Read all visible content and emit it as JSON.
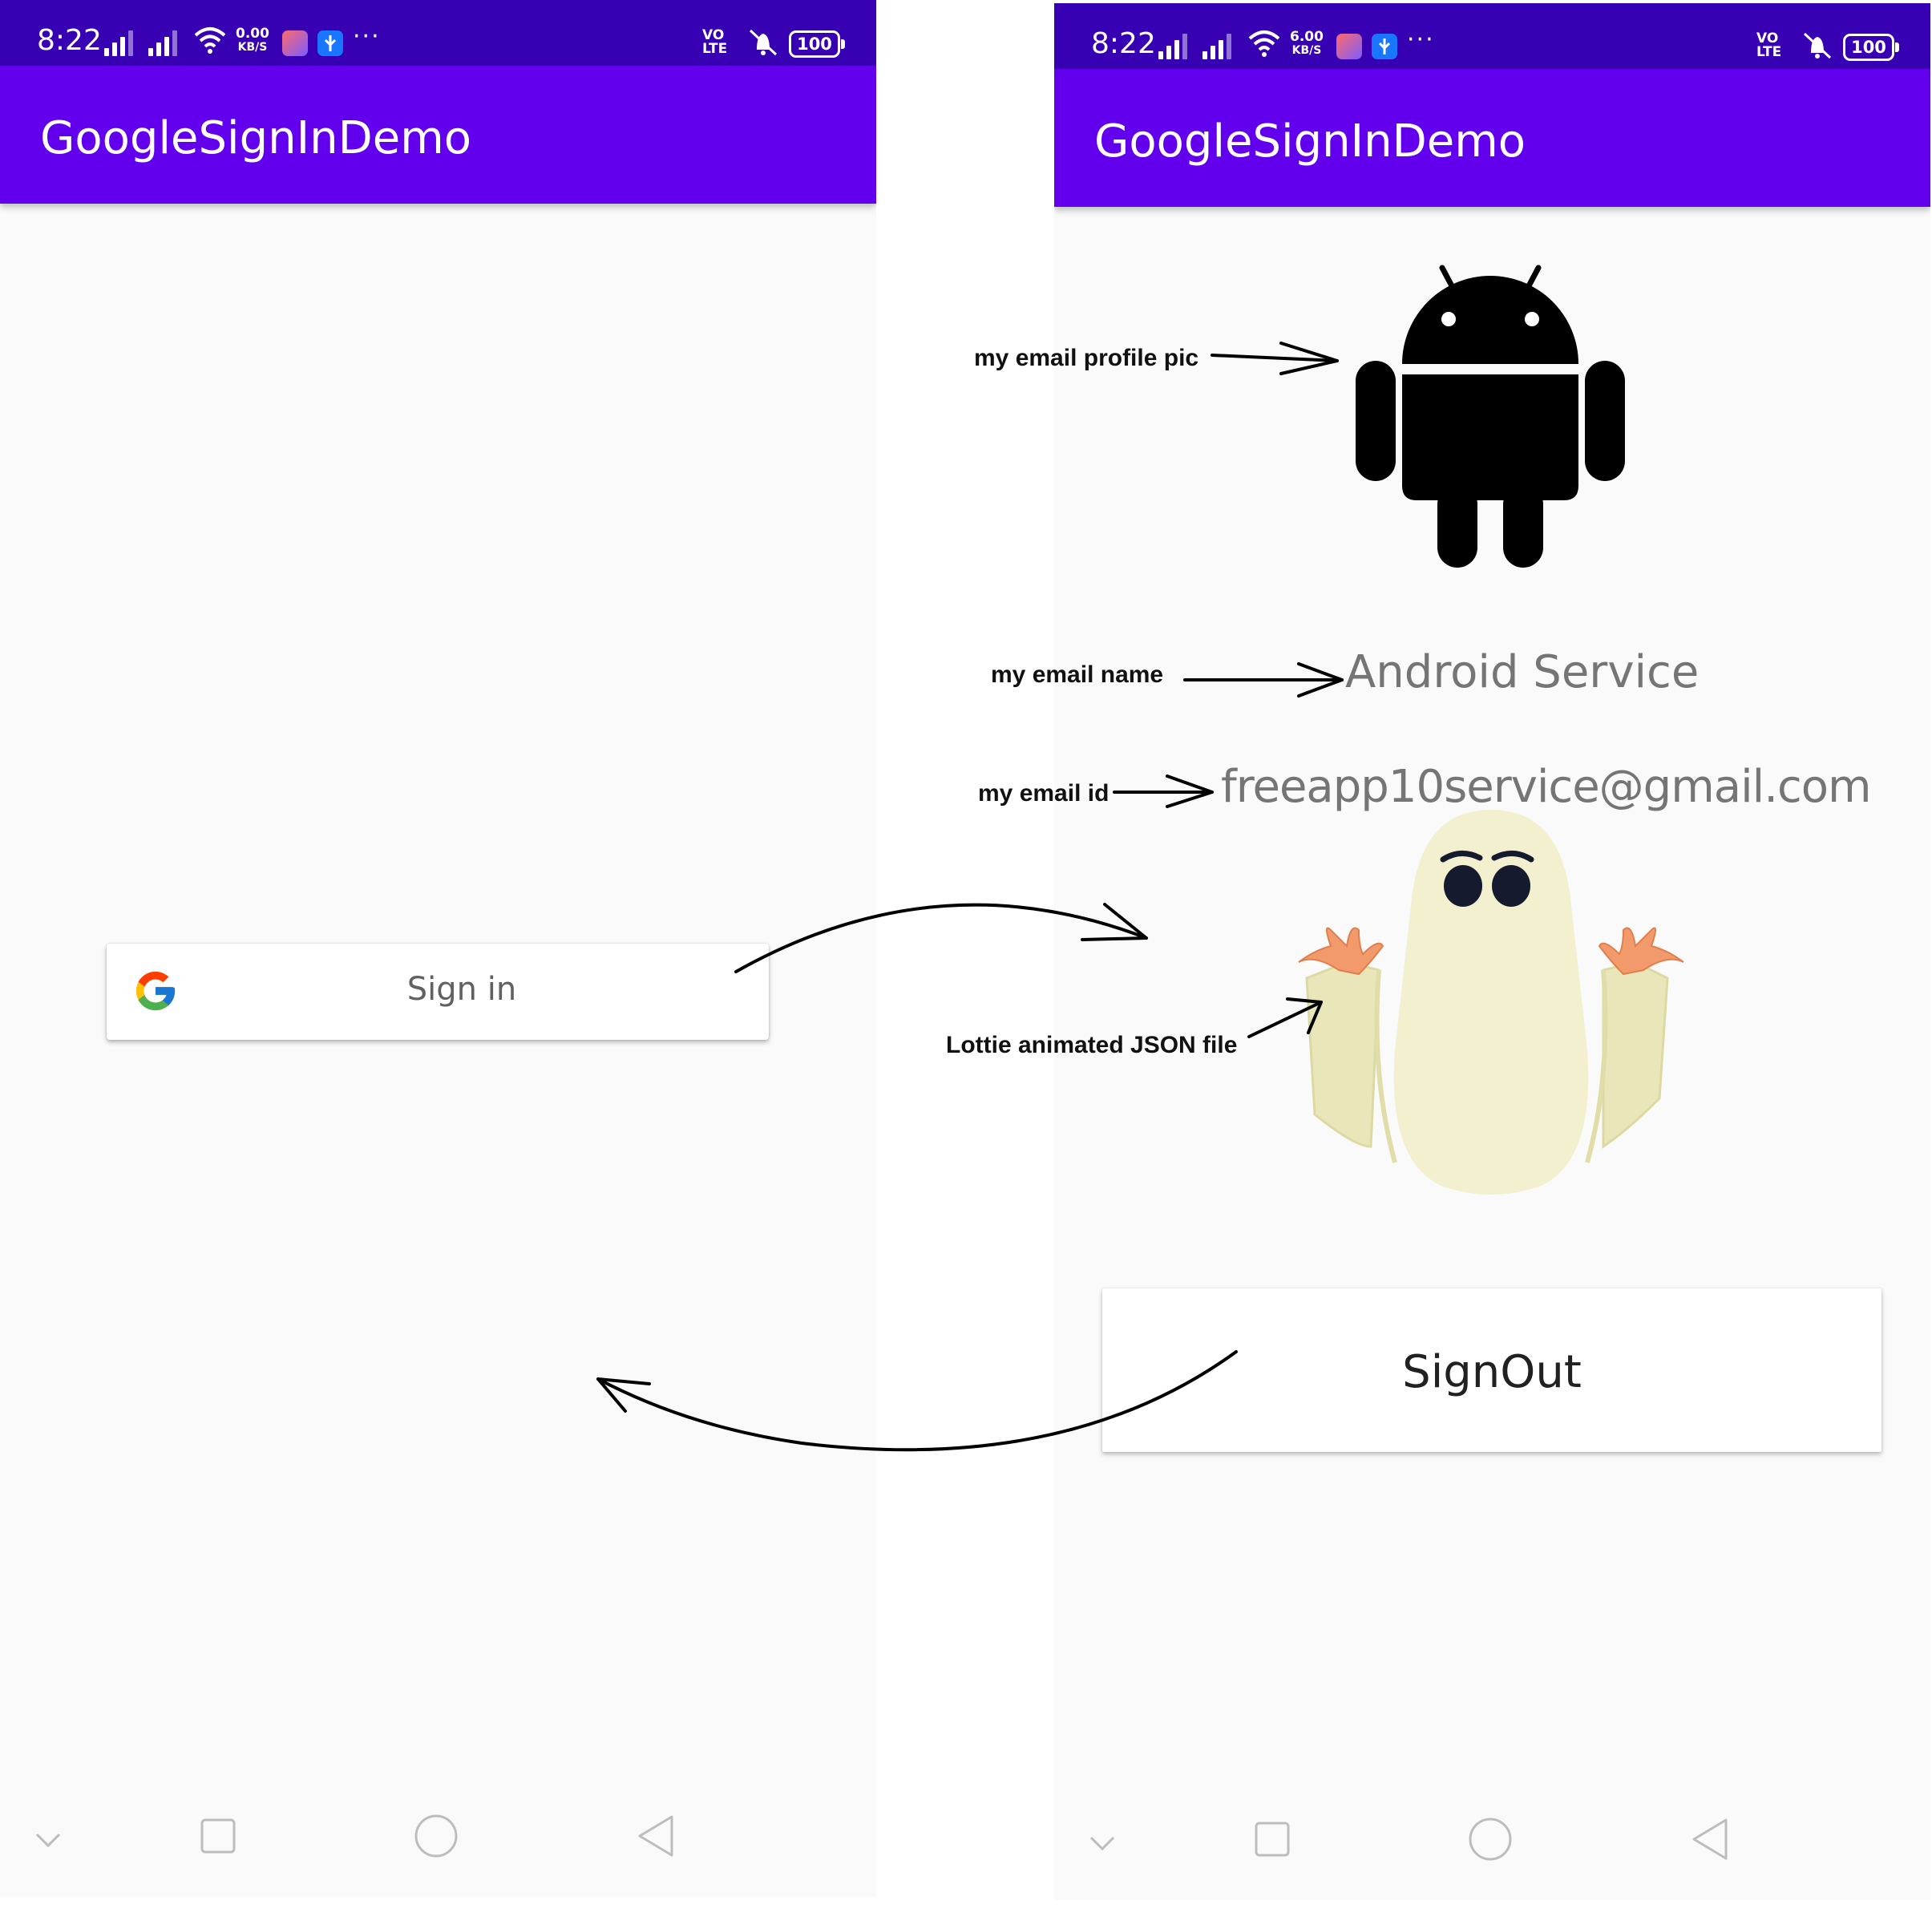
{
  "left_screen": {
    "status_bar": {
      "time": "8:22",
      "net_speed_value": "0.00",
      "net_speed_unit": "KB/S",
      "more": "···",
      "volte_top": "VO",
      "volte_bottom": "LTE",
      "battery": "100"
    },
    "app_bar": {
      "title": "GoogleSignInDemo"
    },
    "sign_in_button": {
      "label": "Sign in",
      "icon": "google-g-icon"
    },
    "nav_bar": {
      "icons": [
        "chevron-down-icon",
        "recents-square-icon",
        "home-circle-icon",
        "back-triangle-icon"
      ]
    }
  },
  "right_screen": {
    "status_bar": {
      "time": "8:22",
      "net_speed_value": "6.00",
      "net_speed_unit": "KB/S",
      "more": "···",
      "volte_top": "VO",
      "volte_bottom": "LTE",
      "battery": "100"
    },
    "app_bar": {
      "title": "GoogleSignInDemo"
    },
    "profile": {
      "picture_icon": "android-robot-icon",
      "name": "Android Service",
      "email": "freeapp10service@gmail.com"
    },
    "animation": {
      "icon": "ghost-lottie-animation"
    },
    "sign_out_button": {
      "label": "SignOut"
    },
    "nav_bar": {
      "icons": [
        "chevron-down-icon",
        "recents-square-icon",
        "home-circle-icon",
        "back-triangle-icon"
      ]
    }
  },
  "annotations": {
    "profile_pic": "my email profile pic",
    "email_name": "my email name",
    "email_id": "my email id",
    "lottie": "Lottie animated JSON file"
  },
  "colors": {
    "status_bar": "#3700b3",
    "app_bar": "#6200ee",
    "background": "#fafafa"
  }
}
